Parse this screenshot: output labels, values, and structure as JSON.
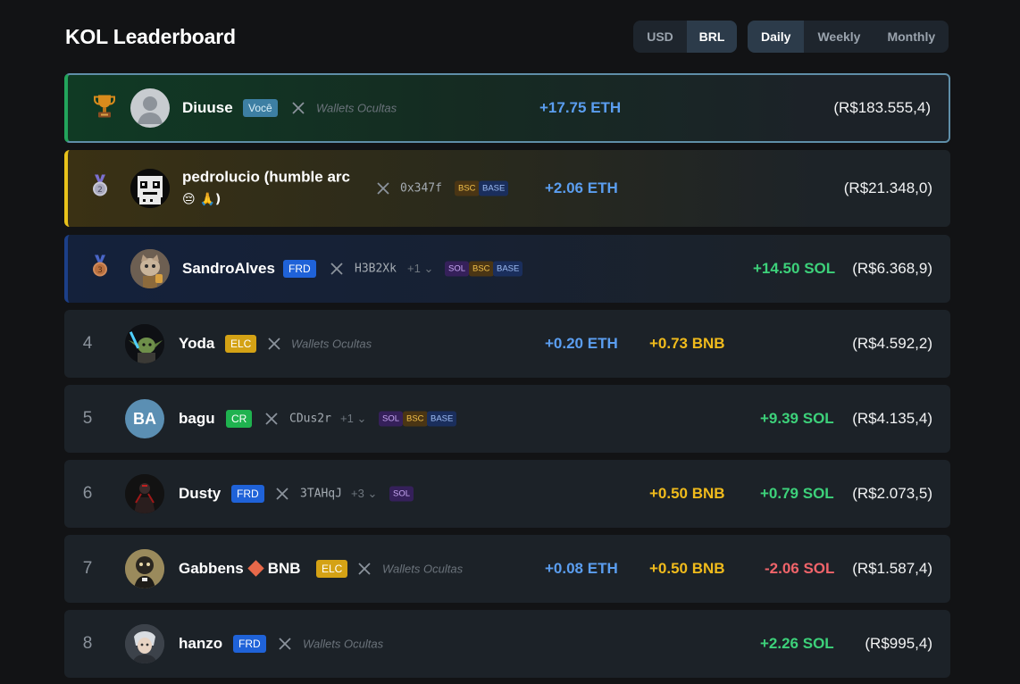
{
  "header": {
    "title": "KOL Leaderboard"
  },
  "currency_toggle": {
    "options": [
      "USD",
      "BRL"
    ],
    "selected": "BRL"
  },
  "period_toggle": {
    "options": [
      "Daily",
      "Weekly",
      "Monthly"
    ],
    "selected": "Daily"
  },
  "rows": [
    {
      "rank": "1",
      "medal": "trophy-icon",
      "name": "Diuuse",
      "badge": "Você",
      "wallets": "Wallets Ocultas",
      "eth": "+17.75 ETH",
      "fiat": "(R$183.555,4)"
    },
    {
      "rank": "2",
      "medal": "silver-medal-icon",
      "name": "pedrolucio (humble arc 😔 🙏)",
      "name_main": "pedrolucio (humble arc",
      "name_emoji": "😔 🙏)",
      "address": "0x347f",
      "chains": [
        "BSC",
        "BASE"
      ],
      "eth": "+2.06 ETH",
      "fiat": "(R$21.348,0)"
    },
    {
      "rank": "3",
      "medal": "bronze-medal-icon",
      "name": "SandroAlves",
      "badge": "FRD",
      "address": "H3B2Xk",
      "more": "+1",
      "chains": [
        "SOL",
        "BSC",
        "BASE"
      ],
      "sol": "+14.50 SOL",
      "fiat": "(R$6.368,9)"
    },
    {
      "rank": "4",
      "name": "Yoda",
      "badge": "ELC",
      "wallets": "Wallets Ocultas",
      "eth": "+0.20 ETH",
      "bnb": "+0.73 BNB",
      "fiat": "(R$4.592,2)"
    },
    {
      "rank": "5",
      "name": "bagu",
      "initials": "BA",
      "badge": "CR",
      "address": "CDus2r",
      "more": "+1",
      "chains": [
        "SOL",
        "BSC",
        "BASE"
      ],
      "sol": "+9.39 SOL",
      "fiat": "(R$4.135,4)"
    },
    {
      "rank": "6",
      "name": "Dusty",
      "badge": "FRD",
      "address": "3TAHqJ",
      "more": "+3",
      "chains": [
        "SOL"
      ],
      "bnb": "+0.50 BNB",
      "sol": "+0.79 SOL",
      "fiat": "(R$2.073,5)"
    },
    {
      "rank": "7",
      "name": "Gabbens 🔶 BNB",
      "name_main": "Gabbens",
      "name_suffix": "BNB",
      "badge": "ELC",
      "wallets": "Wallets Ocultas",
      "eth": "+0.08 ETH",
      "bnb": "+0.50 BNB",
      "sol": "-2.06 SOL",
      "fiat": "(R$1.587,4)"
    },
    {
      "rank": "8",
      "name": "hanzo",
      "badge": "FRD",
      "wallets": "Wallets Ocultas",
      "sol": "+2.26 SOL",
      "fiat": "(R$995,4)"
    }
  ],
  "colors": {
    "eth": "#5b9ef0",
    "bnb": "#f0bb1c",
    "sol": "#3dd17a",
    "negative": "#f0646a",
    "background": "#121315",
    "row": "#1c2228"
  }
}
